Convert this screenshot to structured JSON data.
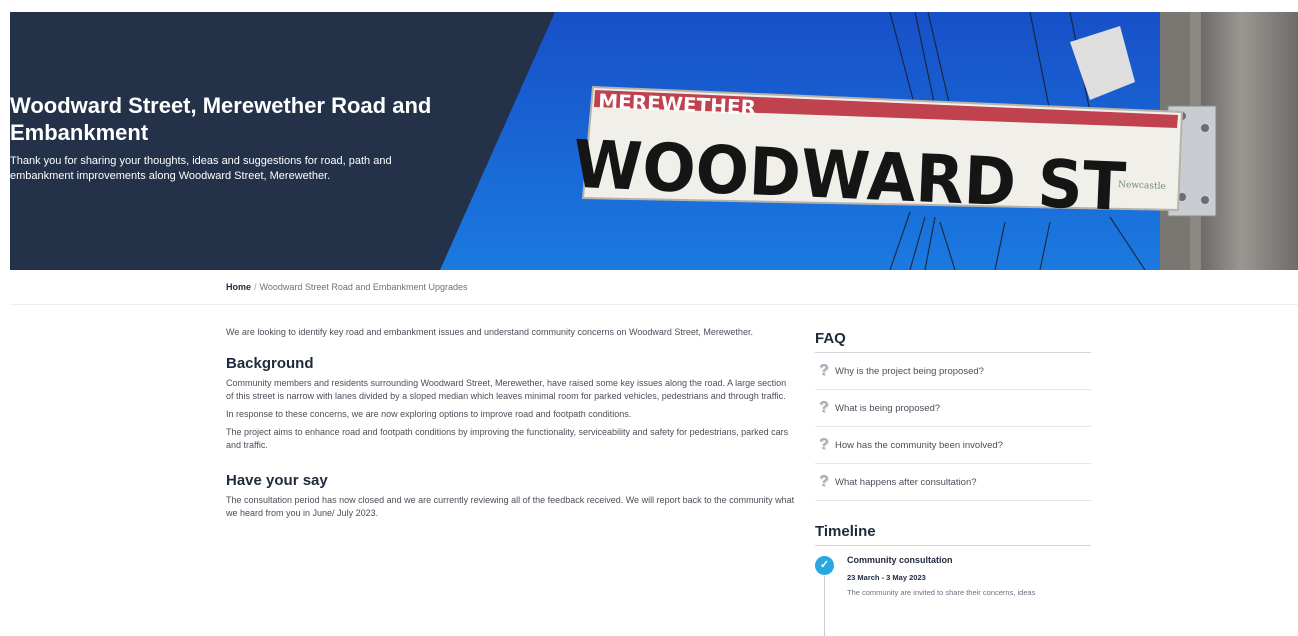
{
  "hero": {
    "title": "Woodward Street, Merewether Road and Embankment",
    "subtitle": "Thank you for sharing your thoughts, ideas and suggestions for road, path and embankment improvements along Woodward Street, Merewether.",
    "sign_top": "MEREWETHER",
    "sign_main": "WOODWARD ST",
    "sign_logo": "Newcastle"
  },
  "breadcrumb": {
    "home": "Home",
    "separator": "/",
    "current": "Woodward Street Road and Embankment Upgrades"
  },
  "main": {
    "intro": "We are looking to identify key road and embankment issues and understand community concerns on Woodward Street, Merewether.",
    "background_title": "Background",
    "background_p1": "Community members and residents surrounding Woodward Street, Merewether, have raised some key issues along the road. A large section of this street is narrow with lanes divided by a sloped median which leaves minimal room for parked vehicles, pedestrians and through traffic.",
    "background_p2": "In response to these concerns, we are now exploring options to improve road and footpath conditions.",
    "background_p3": "The project aims to enhance road and footpath conditions by improving the functionality, serviceability and safety for pedestrians, parked cars and traffic.",
    "have_your_say_title": "Have your say",
    "have_your_say_p1": "The consultation period has now closed and we are currently reviewing all of the feedback received. We will report back to the community what we heard from you in June/ July 2023."
  },
  "faq": {
    "title": "FAQ",
    "items": [
      "Why is the project being proposed?",
      "What is being proposed?",
      "How has the community been involved?",
      "What happens after consultation?"
    ]
  },
  "timeline": {
    "title": "Timeline",
    "items": [
      {
        "title": "Community consultation",
        "date": "23 March - 3 May 2023",
        "desc": "The community are invited to share their concerns, ideas"
      }
    ]
  },
  "colors": {
    "navy": "#233149",
    "accent": "#2aa6e0",
    "sky": "#1b6fd8",
    "sign_red": "#c0424f"
  },
  "icons": [
    "question-icon",
    "check-icon"
  ]
}
